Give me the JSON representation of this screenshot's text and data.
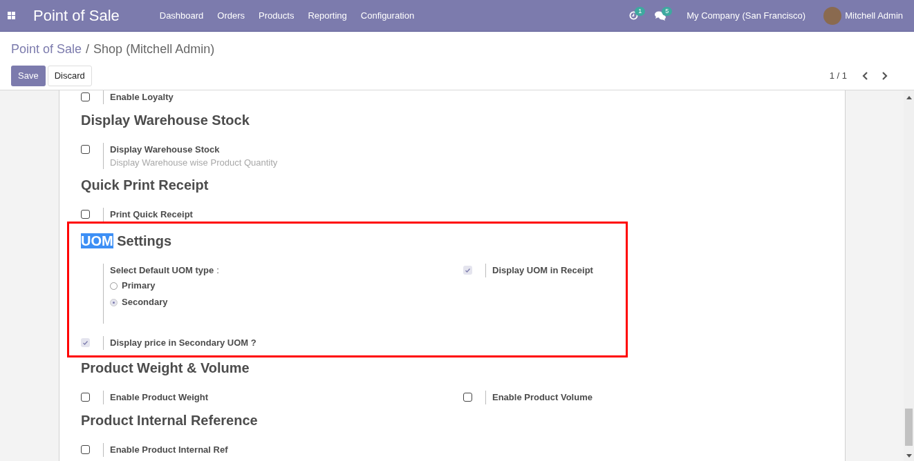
{
  "navbar": {
    "app_name": "Point of Sale",
    "menu": [
      "Dashboard",
      "Orders",
      "Products",
      "Reporting",
      "Configuration"
    ],
    "activity_count": "1",
    "message_count": "5",
    "company": "My Company (San Francisco)",
    "user": "Mitchell Admin"
  },
  "breadcrumb": {
    "parent": "Point of Sale",
    "separator": "/",
    "current": "Shop (Mitchell Admin)"
  },
  "buttons": [
    "Save",
    "Discard"
  ],
  "pager": {
    "text": "1 / 1"
  },
  "sections": [
    {
      "outlined": false,
      "settings": [
        {
          "kind": "checkbox",
          "label": "Enable Loyalty",
          "checked": false
        }
      ]
    },
    {
      "title": [
        {
          "text": "Display Warehouse Stock",
          "highlighted": false
        }
      ],
      "outlined": false,
      "settings": [
        {
          "kind": "checkbox",
          "label": "Display Warehouse Stock",
          "checked": false,
          "description": "Display Warehouse wise Product Quantity"
        }
      ]
    },
    {
      "title": [
        {
          "text": "Quick Print Receipt",
          "highlighted": false
        }
      ],
      "outlined": false,
      "settings": [
        {
          "kind": "checkbox",
          "label": "Print Quick Receipt",
          "checked": false
        }
      ]
    },
    {
      "title": [
        {
          "text": "UOM",
          "highlighted": true
        },
        {
          "text": "Settings",
          "highlighted": false
        }
      ],
      "outlined": true,
      "settings": [
        {
          "kind": "radio",
          "label": "Select Default UOM type",
          "suffix": ":",
          "options": [
            {
              "label": "Primary",
              "selected": false
            },
            {
              "label": "Secondary",
              "selected": true
            }
          ]
        },
        {
          "kind": "checkbox",
          "label": "Display UOM in Receipt",
          "checked": true
        },
        {
          "kind": "checkbox",
          "label": "Display price in Secondary UOM ?",
          "checked": true
        }
      ]
    },
    {
      "title": [
        {
          "text": "Product Weight & Volume",
          "highlighted": false
        }
      ],
      "outlined": false,
      "settings": [
        {
          "kind": "checkbox",
          "label": "Enable Product Weight",
          "checked": false
        },
        {
          "kind": "checkbox",
          "label": "Enable Product Volume",
          "checked": false
        }
      ]
    },
    {
      "title": [
        {
          "text": "Product Internal Reference",
          "highlighted": false
        }
      ],
      "outlined": false,
      "settings": [
        {
          "kind": "checkbox",
          "label": "Enable Product Internal Ref",
          "checked": false
        }
      ]
    }
  ]
}
